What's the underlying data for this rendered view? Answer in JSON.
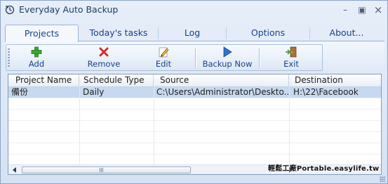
{
  "window": {
    "title": "Everyday Auto Backup"
  },
  "tabs": [
    {
      "label": "Projects",
      "active": true
    },
    {
      "label": "Today's tasks",
      "active": false
    },
    {
      "label": "Log",
      "active": false
    },
    {
      "label": "Options",
      "active": false
    },
    {
      "label": "About...",
      "active": false
    }
  ],
  "toolbar": {
    "add_label": "Add",
    "remove_label": "Remove",
    "edit_label": "Edit",
    "backup_label": "Backup Now",
    "exit_label": "Exit"
  },
  "grid": {
    "columns": [
      "Project Name",
      "Schedule Type",
      "Source",
      "Destination"
    ],
    "rows": [
      {
        "project": "備份",
        "schedule": "Daily",
        "source": "C:\\Users\\Administrator\\Deskto...",
        "destination": "H:\\22\\Facebook"
      }
    ]
  },
  "watermark": "Portable.easylife.tw",
  "watermark_cjk": "輕鬆工廠",
  "colors": {
    "accent": "#15428b",
    "selection": "#c7d9f1",
    "add_icon": "#3aa935",
    "remove_icon": "#d92b2b",
    "backup_icon": "#2f6fd1"
  }
}
